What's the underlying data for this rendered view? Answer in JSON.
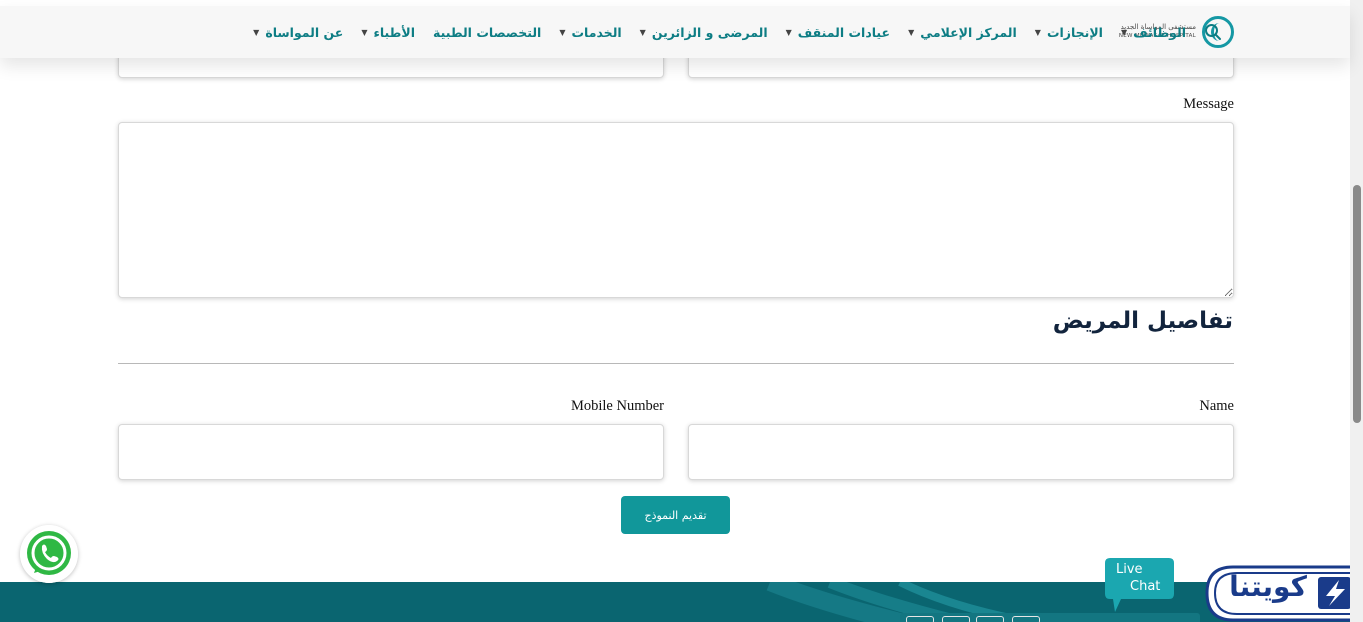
{
  "header": {
    "logo": {
      "arabic": "مستشفى المواساة الجديد",
      "english": "NEW MUWASAT HOSPITAL"
    },
    "nav": [
      {
        "label": "عن المواساة",
        "dropdown": true
      },
      {
        "label": "الأطباء",
        "dropdown": true
      },
      {
        "label": "التخصصات الطبية",
        "dropdown": false
      },
      {
        "label": "الخدمات",
        "dropdown": true
      },
      {
        "label": "المرضى و الزائرين",
        "dropdown": true
      },
      {
        "label": "عيادات المنقف",
        "dropdown": true
      },
      {
        "label": "المركز الإعلامي",
        "dropdown": true
      },
      {
        "label": "الإنجازات",
        "dropdown": true
      },
      {
        "label": "الوظائف",
        "dropdown": true
      }
    ]
  },
  "form": {
    "message_label": "Message",
    "message_value": "",
    "section_title": "تفاصيل المريض",
    "name_label": "Name",
    "name_value": "",
    "mobile_label": "Mobile Number",
    "mobile_value": "",
    "submit_label": "تقديم النموذج"
  },
  "floating": {
    "livechat_line1": "Live",
    "livechat_line2": "Chat",
    "kuwaitna_label": "كويتنا"
  },
  "colors": {
    "nav_text": "#0d7d84",
    "button": "#11979a",
    "footer": "#0a6570",
    "title": "#12243d"
  }
}
